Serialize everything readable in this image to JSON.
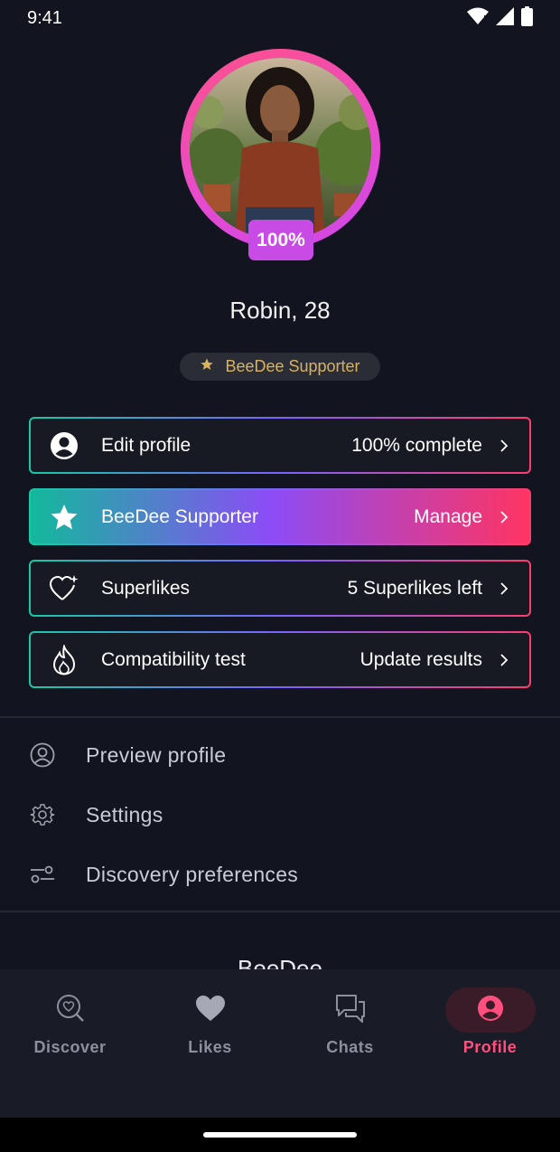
{
  "status_bar": {
    "time": "9:41",
    "icons": [
      "wifi-icon",
      "signal-icon",
      "battery-icon"
    ]
  },
  "profile": {
    "avatar_icon": "profile-photo",
    "completion_badge": "100%",
    "name": "Robin, 28",
    "supporter_pill": {
      "icon": "star-icon",
      "label": "BeeDee Supporter"
    }
  },
  "cards": [
    {
      "icon": "user-circle-icon",
      "label": "Edit profile",
      "value": "100% complete"
    },
    {
      "icon": "star-icon",
      "label": "BeeDee Supporter",
      "value": "Manage"
    },
    {
      "icon": "heart-sparkle-icon",
      "label": "Superlikes",
      "value": "5 Superlikes left"
    },
    {
      "icon": "flame-icon",
      "label": "Compatibility test",
      "value": "Update results"
    }
  ],
  "menu": [
    {
      "icon": "user-circle-outline-icon",
      "label": "Preview profile"
    },
    {
      "icon": "gear-icon",
      "label": "Settings"
    },
    {
      "icon": "sliders-icon",
      "label": "Discovery preferences"
    }
  ],
  "footer": {
    "brand": "BeeDee"
  },
  "bottom_nav": {
    "items": [
      {
        "icon": "discover-icon",
        "label": "Discover",
        "active": false
      },
      {
        "icon": "heart-icon",
        "label": "Likes",
        "active": false
      },
      {
        "icon": "chat-icon",
        "label": "Chats",
        "active": false
      },
      {
        "icon": "profile-icon",
        "label": "Profile",
        "active": true
      }
    ]
  },
  "colors": {
    "background": "#121420",
    "accent_pink": "#ff4f7e",
    "gradient_teal": "#17c9a6",
    "gradient_purple": "#8c4cf6",
    "gradient_red": "#ff3462",
    "supporter_gold": "#d8b25f"
  }
}
